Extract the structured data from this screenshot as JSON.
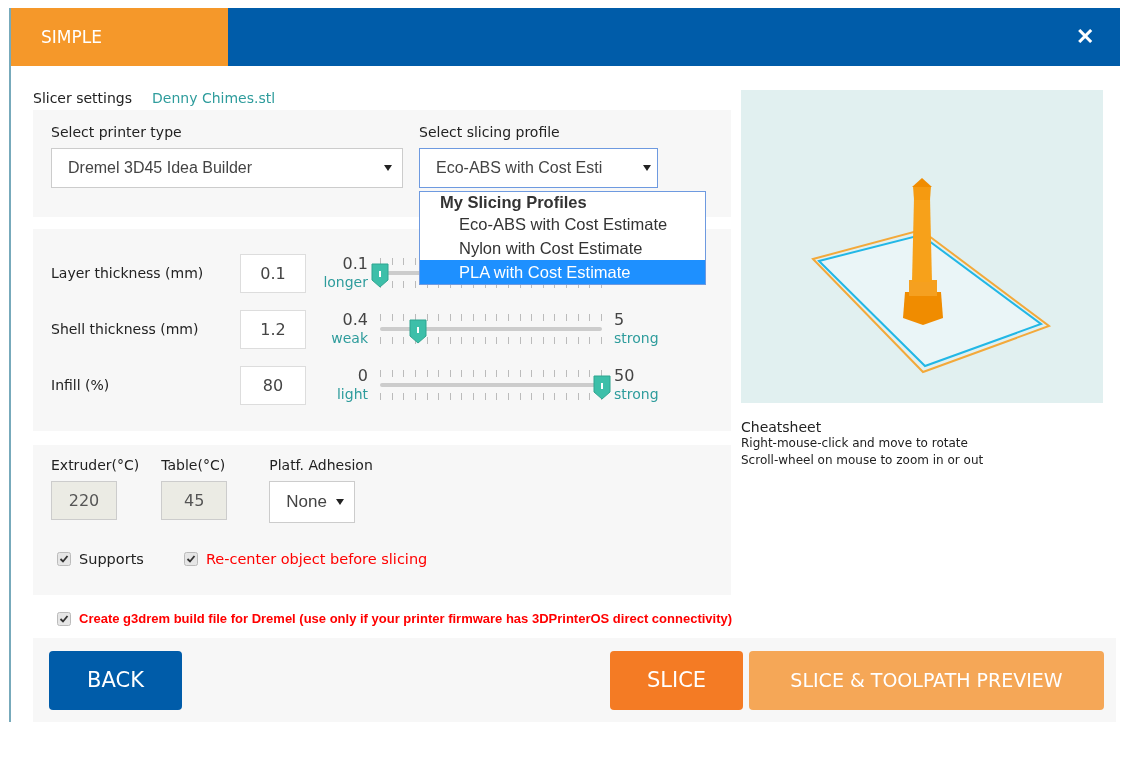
{
  "tabs": [
    {
      "label": "SIMPLE",
      "selected": true
    }
  ],
  "close": "✕",
  "header": {
    "label": "Slicer settings",
    "file": "Denny Chimes.stl"
  },
  "printer": {
    "label": "Select printer type",
    "value": "Dremel 3D45 Idea Builder"
  },
  "profile": {
    "label": "Select slicing profile",
    "value": "Eco-ABS with Cost Esti",
    "expanded": true,
    "group": "My Slicing Profiles",
    "options": [
      {
        "label": "Eco-ABS with Cost Estimate",
        "selected": false
      },
      {
        "label": "Nylon with Cost Estimate",
        "selected": false
      },
      {
        "label": "PLA with Cost Estimate",
        "selected": true
      }
    ]
  },
  "params": [
    {
      "label": "Layer thickness (mm)",
      "value": "0.1",
      "min": "0.1",
      "min_hint": "longer",
      "level": 0
    },
    {
      "label": "Shell thickness (mm)",
      "value": "1.2",
      "min": "0.4",
      "min_hint": "weak",
      "max": "5",
      "max_hint": "strong",
      "level": 0.17
    },
    {
      "label": "Infill (%)",
      "value": "80",
      "min": "0",
      "min_hint": "light",
      "max": "50",
      "max_hint": "strong",
      "level": 1
    }
  ],
  "temps": [
    {
      "label": "Extruder(°C)",
      "value": "220",
      "disabled": true
    },
    {
      "label": "Table(°C)",
      "value": "45",
      "disabled": true
    }
  ],
  "adhesion": {
    "label": "Platf. Adhesion",
    "value": "None"
  },
  "options": [
    {
      "label": "Supports",
      "checked": true,
      "highlight": false
    },
    {
      "label": "Re-center object before slicing",
      "checked": true,
      "highlight": true
    }
  ],
  "g3drem": {
    "label": "Create g3drem build file for Dremel (use only if your printer firmware has 3DPrinterOS direct connectivity)",
    "checked": true,
    "highlight": true
  },
  "cheatsheet": {
    "title": "Cheatsheet",
    "lines": [
      "Right-mouse-click and move to rotate",
      "Scroll-wheel on mouse to zoom in or out"
    ]
  },
  "buttons": [
    {
      "label": "BACK",
      "kind": "back"
    },
    {
      "label": "SLICE",
      "kind": "slice"
    },
    {
      "label": "SLICE & TOOLPATH PREVIEW",
      "kind": "preview"
    }
  ]
}
